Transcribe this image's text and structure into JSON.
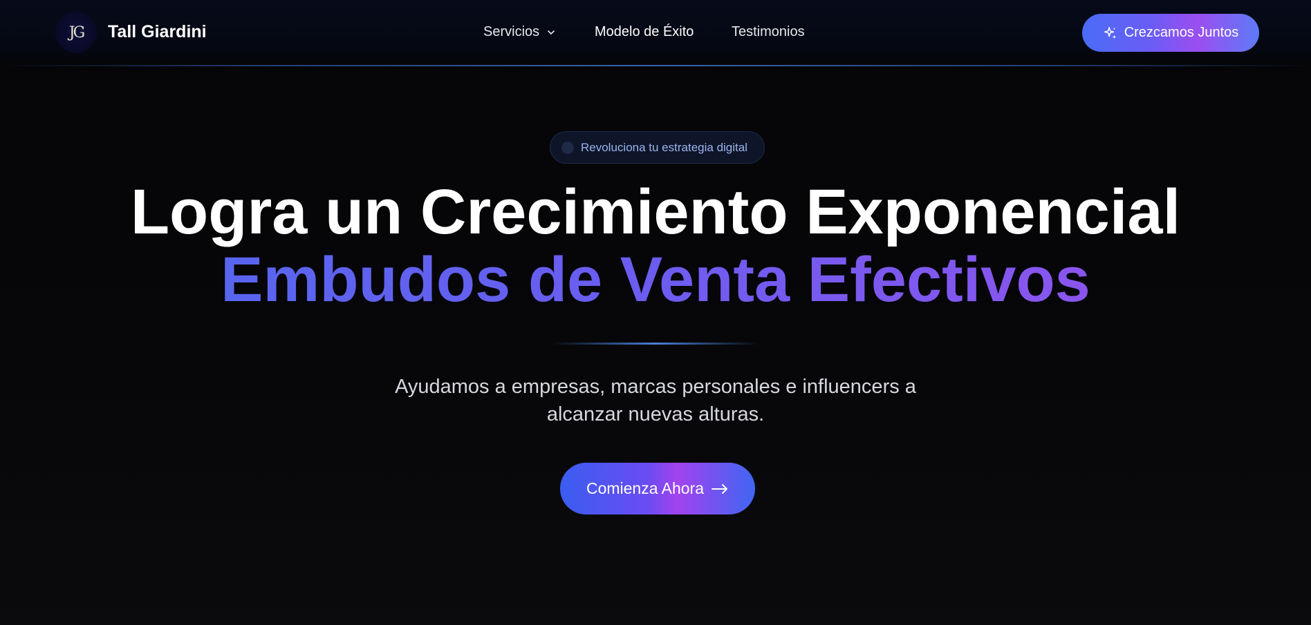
{
  "header": {
    "logo_text": "JG",
    "brand": "Tall Giardini",
    "nav": [
      {
        "label": "Servicios"
      },
      {
        "label": "Modelo de Éxito"
      },
      {
        "label": "Testimonios"
      }
    ],
    "cta_label": "Crezcamos Juntos"
  },
  "hero": {
    "badge": "Revoluciona tu estrategia digital",
    "title_line1": "Logra un Crecimiento Exponencial",
    "title_line2": "Embudos de Venta Efectivos",
    "subtitle": "Ayudamos a empresas, marcas personales e influencers a alcanzar nuevas alturas.",
    "cta_label": "Comienza Ahora"
  },
  "colors": {
    "accent_blue": "#4a6cf7",
    "accent_purple": "#9b4ef0",
    "background": "#050507"
  }
}
